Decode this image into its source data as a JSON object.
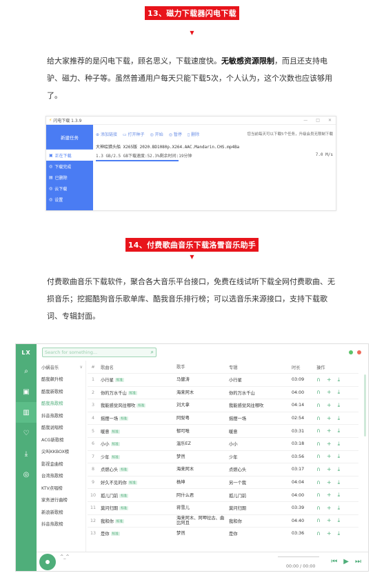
{
  "section1": {
    "title": "13、磁力下载器闪电下载",
    "arrow": "▼",
    "para_a": "给大家推荐的是闪电下载，顾名思义，下载速度快。",
    "para_b": "无敏感资源限制",
    "para_c": "，而且还支持电驴、磁力、种子等。虽然普通用户每天只能下载5次，个人认为，这个次数也应该够用了。"
  },
  "shandian": {
    "window_title": "闪电下载 1.3.9",
    "window_controls": [
      "—",
      "□",
      "✕"
    ],
    "brand": "新建任务",
    "nav": [
      "正在下载",
      "下载完成",
      "已删除",
      "云下载",
      "设置"
    ],
    "toolbar": [
      "添加链接",
      "打开种子",
      "开始",
      "暂停",
      "删除"
    ],
    "info": "您当前每天可以下载5个任务，升级会员无限制下载",
    "task_name": "大神绘猎头船 X265版 2020.BD1080p.X264.AAC.Mandarin.CHS.mp4Ba",
    "task_progress": "1.3 GB/2.5 GB下载速度:52.3%剩余时间:19分钟",
    "task_speed": "7.0 M/s",
    "progress_percent": 52.3
  },
  "section2": {
    "title": "14、付费歌曲音乐下载洛雪音乐助手",
    "arrow": "▼",
    "para": "付费歌曲音乐下载软件，聚合各大音乐平台接口，免费在线试听下载全网付费歌曲、无损音乐；挖掘酷狗音乐歌单库、酷我音乐排行榜；可以选音乐来源接口，支持下载歌词、专辑封面。"
  },
  "lx": {
    "logo": "LX",
    "search_placeholder": "Search for something...",
    "source": "小蜗音乐",
    "lists": [
      "酷我飙升榜",
      "酷我新歌榜",
      "酷我热歌榜",
      "抖音热歌榜",
      "酷我说唱榜",
      "ACG新歌榜",
      "尖叫KKBOX榜",
      "影视金曲榜",
      "台湾热歌榜",
      "KTV点唱榜",
      "家务进行曲榜",
      "新浪新歌榜",
      "抖音热歌榜"
    ],
    "headers": [
      "#",
      "歌曲名",
      "歌手",
      "专辑",
      "时长",
      "操作"
    ],
    "rows": [
      {
        "n": "1",
        "name": "小行星",
        "tag": "标准",
        "artist": "马健涛",
        "album": "小行星",
        "time": "03:09"
      },
      {
        "n": "2",
        "name": "你的万水千山",
        "tag": "标准",
        "artist": "海来阿木",
        "album": "你的万水千山",
        "time": "04:00"
      },
      {
        "n": "3",
        "name": "我能感觉风往哪吹",
        "tag": "标准",
        "artist": "刘大拿",
        "album": "我能感觉风往哪吹",
        "time": "04:14"
      },
      {
        "n": "4",
        "name": "摇摆一场",
        "tag": "标准",
        "artist": "阿梨粤",
        "album": "摇摆一场",
        "time": "02:54"
      },
      {
        "n": "5",
        "name": "暖意",
        "tag": "标准",
        "artist": "郁可唯",
        "album": "暖意",
        "time": "03:31"
      },
      {
        "n": "6",
        "name": "小小",
        "tag": "标准",
        "artist": "温乐EZ",
        "album": "小小",
        "time": "03:18"
      },
      {
        "n": "7",
        "name": "少年",
        "tag": "标准",
        "artist": "梦然",
        "album": "少年",
        "time": "03:56"
      },
      {
        "n": "8",
        "name": "点燃心头",
        "tag": "标准",
        "artist": "海来阿木",
        "album": "点燃心头",
        "time": "03:17"
      },
      {
        "n": "9",
        "name": "好久不见的你",
        "tag": "标准",
        "artist": "杨坤",
        "album": "另一个我",
        "time": "04:04"
      },
      {
        "n": "10",
        "name": "孤儿门前",
        "tag": "标准",
        "artist": "阿什么君",
        "album": "孤儿门前",
        "time": "04:00"
      },
      {
        "n": "11",
        "name": "莫问归期",
        "tag": "标准",
        "artist": "蒋雪儿",
        "album": "莫问归期",
        "time": "03:39"
      },
      {
        "n": "12",
        "name": "我和你",
        "tag": "标准",
        "artist": "海来阿木、阿呷拉古、曲比阿且",
        "album": "我和你",
        "time": "04:40"
      },
      {
        "n": "13",
        "name": "是你",
        "tag": "标准",
        "artist": "梦然",
        "album": "是你",
        "time": "03:36"
      }
    ],
    "player_title": "^_^",
    "player_time": "00:00 / 00:00",
    "dot_colors": [
      "#5cc36a",
      "#ef6b5a"
    ]
  }
}
